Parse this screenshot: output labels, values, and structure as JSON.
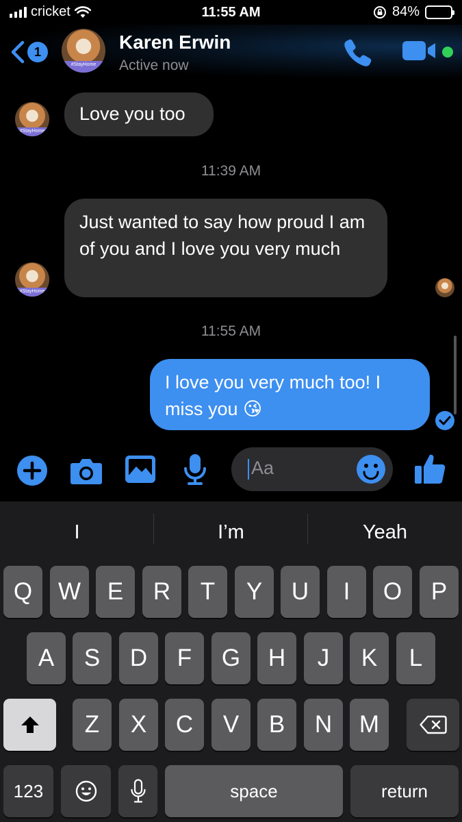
{
  "status_bar": {
    "carrier": "cricket",
    "time": "11:55 AM",
    "battery_percent": "84%",
    "battery_level": 0.84
  },
  "header": {
    "back_count": "1",
    "contact_name": "Karen Erwin",
    "presence": "Active now",
    "avatar_band_text": "#StayHome",
    "icons": [
      "chevron-left-icon",
      "phone-icon",
      "video-camera-icon"
    ]
  },
  "conversation": {
    "messages": [
      {
        "direction": "incoming",
        "text": "Love you too"
      },
      {
        "direction": "incoming",
        "text": "Just wanted to say how proud I am of you and I love you very much"
      },
      {
        "direction": "outgoing",
        "text": "I love you very much too! I miss you 😘"
      }
    ],
    "timestamps": [
      "11:39 AM",
      "11:55 AM"
    ]
  },
  "composer": {
    "placeholder": "Aa",
    "icons": [
      "plus-icon",
      "camera-icon",
      "image-icon",
      "microphone-icon",
      "emoji-icon",
      "thumbs-up-icon"
    ]
  },
  "keyboard": {
    "suggestions": [
      "I",
      "I’m",
      "Yeah"
    ],
    "row1": [
      "Q",
      "W",
      "E",
      "R",
      "T",
      "Y",
      "U",
      "I",
      "O",
      "P"
    ],
    "row2": [
      "A",
      "S",
      "D",
      "F",
      "G",
      "H",
      "J",
      "K",
      "L"
    ],
    "row3": [
      "Z",
      "X",
      "C",
      "V",
      "B",
      "N",
      "M"
    ],
    "numbers_key": "123",
    "space_key": "space",
    "return_key": "return"
  },
  "colors": {
    "accent": "#3d8ff0",
    "incoming_bubble": "#303030",
    "online": "#31d158",
    "key": "#5b5b5e"
  }
}
